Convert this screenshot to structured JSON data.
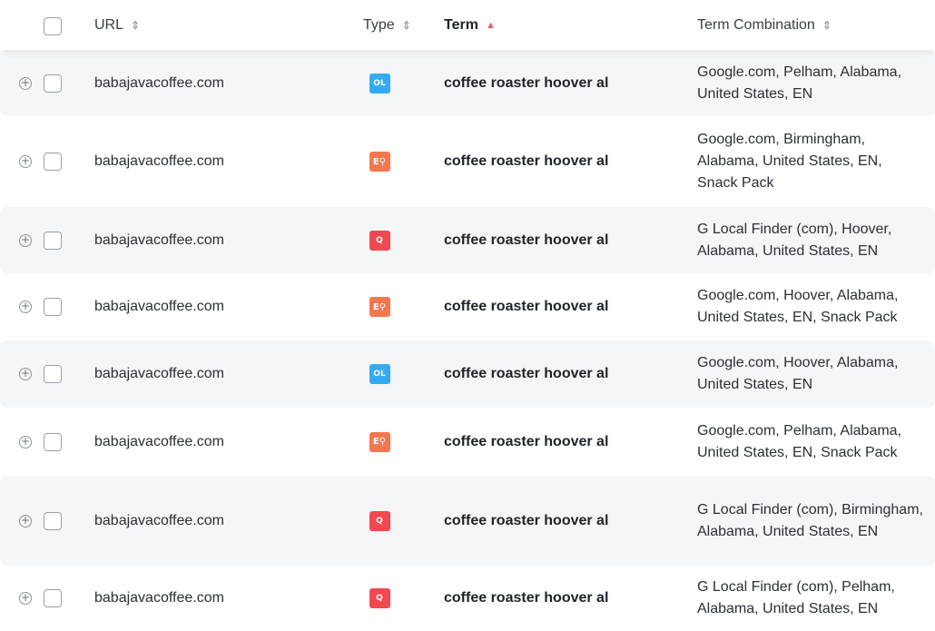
{
  "header": {
    "url_label": "URL",
    "type_label": "Type",
    "term_label": "Term",
    "combo_label": "Term Combination",
    "sort_both_icon": "⇕",
    "sort_up_icon": "▲"
  },
  "colors": {
    "ol_badge": "#35aaf4",
    "ep_badge": "#f4774f",
    "local_badge": "#f2484f",
    "row_shade": "#f5f6f8"
  },
  "rows": [
    {
      "url": "babajavacoffee.com",
      "type": "ol",
      "badge": "OL",
      "term": "coffee roaster hoover al",
      "combo": "Google.com, Pelham, Alabama, United States, EN"
    },
    {
      "url": "babajavacoffee.com",
      "type": "ep",
      "badge": "E⚲",
      "term": "coffee roaster hoover al",
      "combo": "Google.com, Birmingham, Alabama, United States, EN, Snack Pack"
    },
    {
      "url": "babajavacoffee.com",
      "type": "lf",
      "badge": "Q",
      "term": "coffee roaster hoover al",
      "combo": "G Local Finder (com), Hoover, Alabama, United States, EN"
    },
    {
      "url": "babajavacoffee.com",
      "type": "ep",
      "badge": "E⚲",
      "term": "coffee roaster hoover al",
      "combo": "Google.com, Hoover, Alabama, United States, EN, Snack Pack"
    },
    {
      "url": "babajavacoffee.com",
      "type": "ol",
      "badge": "OL",
      "term": "coffee roaster hoover al",
      "combo": "Google.com, Hoover, Alabama, United States, EN"
    },
    {
      "url": "babajavacoffee.com",
      "type": "ep",
      "badge": "E⚲",
      "term": "coffee roaster hoover al",
      "combo": "Google.com, Pelham, Alabama, United States, EN, Snack Pack"
    },
    {
      "url": "babajavacoffee.com",
      "type": "lf",
      "badge": "Q",
      "term": "coffee roaster hoover al",
      "combo": "G Local Finder (com), Birmingham, Alabama, United States, EN"
    },
    {
      "url": "babajavacoffee.com",
      "type": "lf",
      "badge": "Q",
      "term": "coffee roaster hoover al",
      "combo": "G Local Finder (com), Pelham, Alabama, United States, EN"
    }
  ]
}
